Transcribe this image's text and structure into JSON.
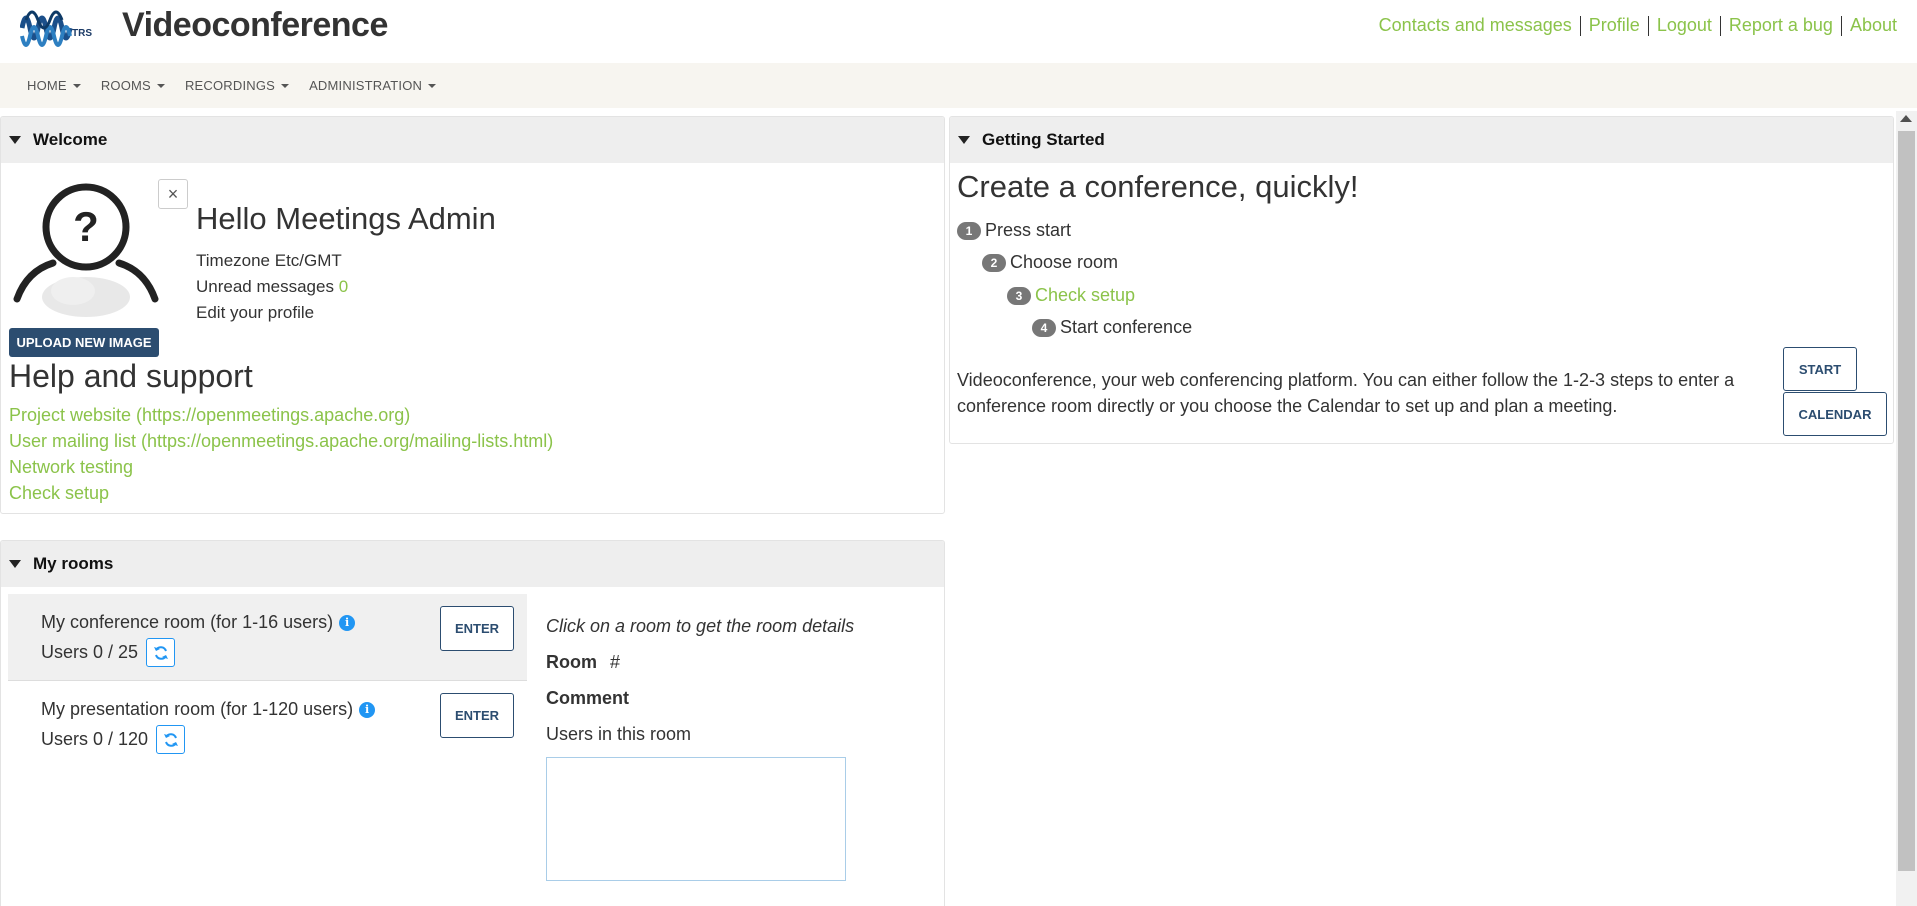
{
  "header": {
    "title": "Videoconference",
    "links": [
      "Contacts and messages",
      "Profile",
      "Logout",
      "Report a bug",
      "About"
    ]
  },
  "nav": {
    "items": [
      "HOME",
      "ROOMS",
      "RECORDINGS",
      "ADMINISTRATION"
    ]
  },
  "welcome": {
    "panel_title": "Welcome",
    "close_glyph": "×",
    "hello": "Hello Meetings Admin",
    "timezone": "Timezone Etc/GMT",
    "unread_label": "Unread messages",
    "unread_count": "0",
    "edit_profile": "Edit your profile",
    "upload_label": "UPLOAD NEW IMAGE",
    "help_title": "Help and support",
    "help_links": [
      "Project website (https://openmeetings.apache.org)",
      "User mailing list (https://openmeetings.apache.org/mailing-lists.html)",
      "Network testing",
      "Check setup"
    ]
  },
  "getting_started": {
    "panel_title": "Getting Started",
    "headline": "Create a conference, quickly!",
    "steps": [
      {
        "num": "1",
        "label": "Press start"
      },
      {
        "num": "2",
        "label": "Choose room"
      },
      {
        "num": "3",
        "label": "Check setup"
      },
      {
        "num": "4",
        "label": "Start conference"
      }
    ],
    "description": "Videoconference, your web conferencing platform. You can either follow the 1-2-3 steps to enter a conference room directly or you choose the Calendar to set up and plan a meeting.",
    "start_label": "START",
    "calendar_label": "CALENDAR"
  },
  "my_rooms": {
    "panel_title": "My rooms",
    "rooms": [
      {
        "name": "My conference room (for 1-16 users)",
        "users": "Users 0 / 25",
        "enter": "ENTER"
      },
      {
        "name": "My presentation room (for 1-120 users)",
        "users": "Users 0 / 120",
        "enter": "ENTER"
      }
    ],
    "details_hint": "Click on a room to get the room details",
    "room_label": "Room",
    "room_value": "#",
    "comment_label": "Comment",
    "users_in_room": "Users in this room"
  },
  "colors": {
    "link": "#8bc34a",
    "primary": "#2c4d70",
    "info": "#2196f3",
    "panel_header": "#eeeeee",
    "nav_bg": "#f7f5f0"
  },
  "icons": {
    "logo": "wave-logo-icon",
    "info": "info-icon",
    "refresh": "refresh-icon",
    "collapse": "triangle-down-icon",
    "avatar": "unknown-user-icon"
  }
}
